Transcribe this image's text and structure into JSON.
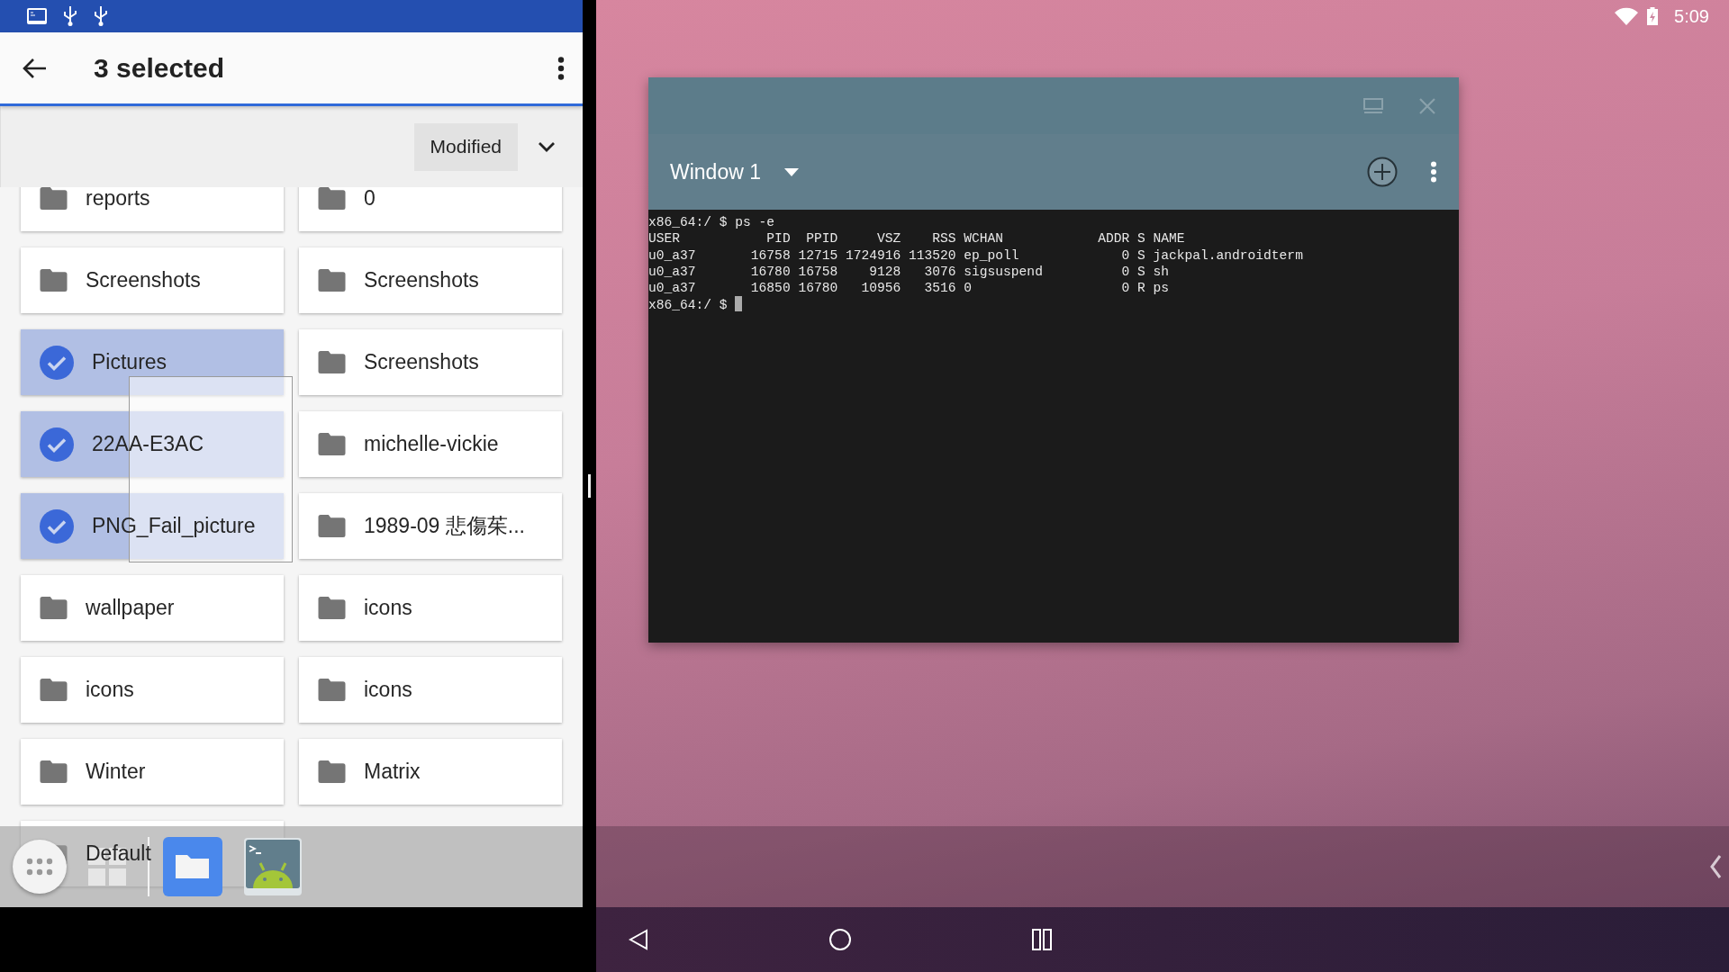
{
  "files_app": {
    "title": "3 selected",
    "sort_label": "Modified",
    "folders": [
      {
        "name": "reports",
        "selected": false
      },
      {
        "name": "0",
        "selected": false
      },
      {
        "name": "Screenshots",
        "selected": false
      },
      {
        "name": "Screenshots",
        "selected": false
      },
      {
        "name": "Pictures",
        "selected": true
      },
      {
        "name": "Screenshots",
        "selected": false
      },
      {
        "name": "22AA-E3AC",
        "selected": true
      },
      {
        "name": "michelle-vickie",
        "selected": false
      },
      {
        "name": "PNG_Fail_picture",
        "selected": true
      },
      {
        "name": "1989-09 悲傷茱...",
        "selected": false
      },
      {
        "name": "wallpaper",
        "selected": false
      },
      {
        "name": "icons",
        "selected": false
      },
      {
        "name": "icons",
        "selected": false
      },
      {
        "name": "icons",
        "selected": false
      },
      {
        "name": "Winter",
        "selected": false
      },
      {
        "name": "Matrix",
        "selected": false
      },
      {
        "name": "Default",
        "selected": false
      }
    ]
  },
  "terminal": {
    "window_title": "Window 1",
    "lines": [
      "x86_64:/ $ ps -e",
      "USER           PID  PPID     VSZ    RSS WCHAN            ADDR S NAME",
      "u0_a37       16758 12715 1724916 113520 ep_poll             0 S jackpal.androidterm",
      "u0_a37       16780 16758    9128   3076 sigsuspend          0 S sh",
      "u0_a37       16850 16780   10956   3516 0                   0 R ps"
    ],
    "prompt": "x86_64:/ $ "
  },
  "status_bar": {
    "time": "5:09"
  }
}
